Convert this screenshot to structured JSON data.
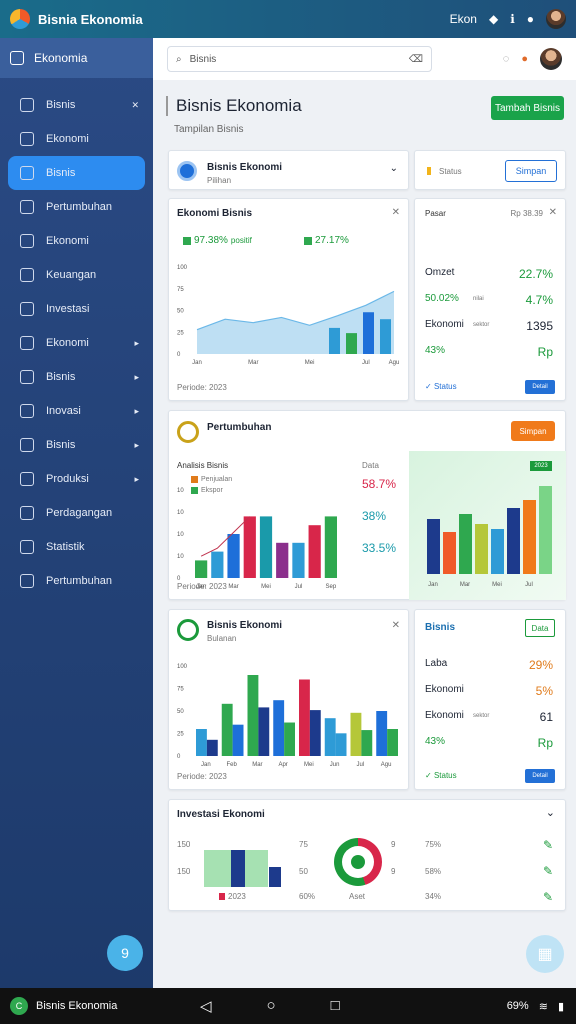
{
  "app": {
    "title": "Bisnia Ekonomia"
  },
  "topbar": {
    "icons": [
      "sync-icon",
      "extension-icon",
      "info-icon",
      "notification-icon",
      "avatar"
    ],
    "status": "Ekon"
  },
  "sidebar": {
    "header": "Ekonomia",
    "items": [
      {
        "label": "Bisnis",
        "icon": "home-icon"
      },
      {
        "label": "Ekonomi",
        "icon": "layers-icon"
      },
      {
        "label": "Bisnis",
        "icon": "document-icon",
        "active": true
      },
      {
        "label": "Pertumbuhan",
        "icon": "globe-icon"
      },
      {
        "label": "Ekonomi",
        "icon": "pencil-icon"
      },
      {
        "label": "Keuangan",
        "icon": "chart-icon"
      },
      {
        "label": "Investasi",
        "icon": "grid-icon"
      },
      {
        "label": "Ekonomi",
        "icon": "table-icon"
      },
      {
        "label": "Bisnis",
        "icon": "settings-icon"
      },
      {
        "label": "Inovasi",
        "icon": "box-icon"
      },
      {
        "label": "Bisnis",
        "icon": "star-icon"
      },
      {
        "label": "Produksi",
        "icon": "edit-icon"
      },
      {
        "label": "Perdagangan",
        "icon": "people-icon"
      },
      {
        "label": "Statistik",
        "icon": "chart-line-icon"
      },
      {
        "label": "Pertumbuhan",
        "icon": "badge-icon"
      }
    ],
    "fab": "9"
  },
  "search": {
    "placeholder": "Bisnis"
  },
  "page": {
    "title": "Bisnis Ekonomia",
    "subtitle": "Tampilan Bisnis",
    "action": "Tambah Bisnis"
  },
  "selector": {
    "title": "Bisnis Ekonomi",
    "sub": "Pilihan",
    "note": "Status",
    "button": "Simpan"
  },
  "card1": {
    "title": "Ekonomi Bisnis",
    "legend1": "97.38%",
    "legend1_sub": "positif",
    "legend2": "27.17%",
    "yticks": [
      "100",
      "75",
      "50",
      "25",
      "0"
    ],
    "xlabels": [
      "Jan",
      "Feb",
      "Mar",
      "Apr",
      "Mei",
      "Jun",
      "Jul",
      "Agu"
    ],
    "footer": "Periode: 2023",
    "side_title": "Pasar",
    "side_sub": "Rp 38.39",
    "rows": [
      {
        "label": "Omzet",
        "value": "22.7%",
        "color": "green"
      },
      {
        "label": "50.02%",
        "value": "4.7%",
        "color": "green",
        "sub": "nilai"
      },
      {
        "label": "Ekonomi",
        "value": "1395",
        "color": "black",
        "sub": "sektor"
      },
      {
        "label": "43%",
        "value": "Rp",
        "color": "green"
      }
    ],
    "side_footer": "Status",
    "side_button": "Detail"
  },
  "card2": {
    "title": "Pertumbuhan",
    "button": "Simpan",
    "chart_title": "Analisis Bisnis",
    "legend": "Penjualan",
    "legend2": "Ekspor",
    "yticks": [
      "10",
      "10",
      "10",
      "10",
      "0"
    ],
    "xlabels": [
      "Jan",
      "Feb",
      "Mar",
      "Apr",
      "Mei",
      "Jun",
      "Jul",
      "Agu",
      "Sep"
    ],
    "right_label": "Data",
    "stats": [
      "58.7%",
      "38%",
      "33.5%"
    ],
    "footer": "Periode: 2023",
    "right_badge": "2023",
    "right_xlabels": [
      "Jan",
      "Feb",
      "Mar",
      "Apr",
      "Mei",
      "Jun",
      "Jul",
      "Agu"
    ]
  },
  "card3": {
    "title": "Bisnis Ekonomi",
    "sub": "Bulanan",
    "yticks": [
      "100",
      "75",
      "50",
      "25",
      "0"
    ],
    "xlabels": [
      "Jan",
      "Feb",
      "Mar",
      "Apr",
      "Mei",
      "Jun",
      "Jul",
      "Agu"
    ],
    "footer": "Periode: 2023",
    "side_title": "Bisnis",
    "side_button": "Data",
    "rows": [
      {
        "label": "Laba",
        "value": "29%",
        "color": "orange"
      },
      {
        "label": "Ekonomi",
        "value": "5%",
        "color": "orange"
      },
      {
        "label": "Ekonomi",
        "value": "61",
        "color": "black",
        "sub": "sektor"
      },
      {
        "label": "43%",
        "value": "Rp",
        "color": "green"
      }
    ],
    "side_footer": "Status",
    "side_button2": "Detail"
  },
  "card4": {
    "title": "Investasi Ekonomi",
    "yticks": [
      "150",
      "150"
    ],
    "legend": "2023",
    "mid_labels": [
      "75",
      "50",
      "60%"
    ],
    "ring_label": "Aset",
    "right_labels": [
      "75%",
      "58%",
      "34%"
    ]
  },
  "bottom": {
    "app": "Bisnis Ekonomia",
    "tray": "69%"
  },
  "chart_data": [
    {
      "type": "area",
      "series": [
        {
          "values": [
            28,
            40,
            36,
            42,
            33,
            44,
            56,
            72
          ]
        }
      ],
      "overlay_bars": [
        {
          "values": [
            30,
            24,
            48,
            40
          ]
        }
      ],
      "ylim": [
        0,
        100
      ],
      "xlabels": [
        "Jan",
        "Feb",
        "Mar",
        "Apr",
        "Mei",
        "Jun",
        "Jul",
        "Agu"
      ]
    },
    {
      "type": "bar",
      "categories": [
        "Jan",
        "Feb",
        "Mar",
        "Apr",
        "Mei",
        "Jun",
        "Jul",
        "Agu",
        "Sep"
      ],
      "series": [
        {
          "values": [
            2,
            3,
            5,
            7,
            7,
            4,
            4,
            6,
            7
          ]
        }
      ],
      "ylim": [
        0,
        10
      ]
    },
    {
      "type": "bar",
      "categories": [
        "Jan",
        "Feb",
        "Mar",
        "Apr",
        "Mei",
        "Jun",
        "Jul",
        "Agu"
      ],
      "series": [
        {
          "values": [
            55,
            42,
            60,
            50,
            45,
            66,
            74,
            88
          ]
        }
      ]
    },
    {
      "type": "bar",
      "categories": [
        "Jan",
        "Feb",
        "Mar",
        "Apr",
        "Mei",
        "Jun",
        "Jul",
        "Agu"
      ],
      "series": [
        {
          "values": [
            30,
            58,
            90,
            62,
            85,
            42,
            48,
            50
          ]
        }
      ],
      "ylim": [
        0,
        100
      ]
    }
  ]
}
